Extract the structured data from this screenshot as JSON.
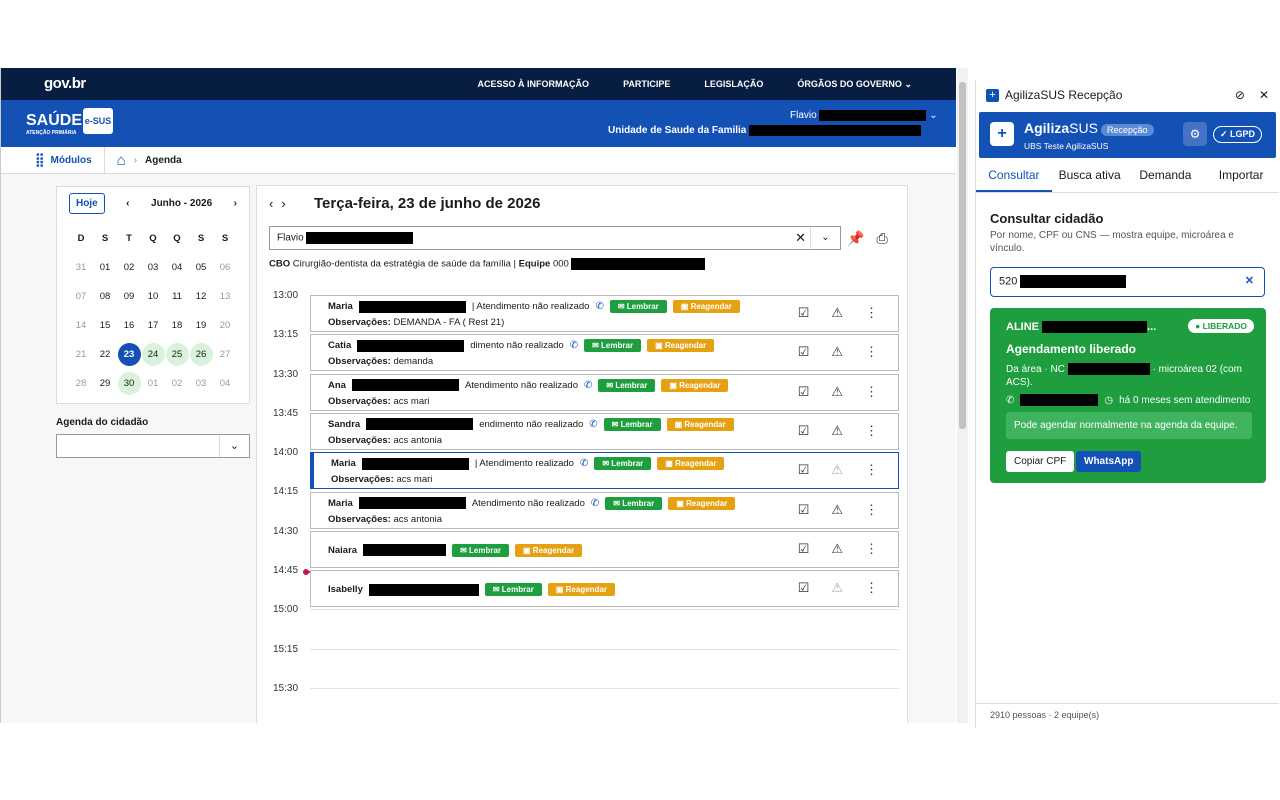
{
  "gov": {
    "logo": "gov.br",
    "links": [
      "ACESSO À INFORMAÇÃO",
      "PARTICIPE",
      "LEGISLAÇÃO",
      "ÓRGÃOS DO GOVERNO"
    ]
  },
  "header": {
    "brand": "SAÚDE",
    "brand_sub": "ATENÇÃO PRIMÁRIA",
    "esus": "e-SUS",
    "user": "Flavio",
    "unit": "Unidade de Saude da Familia"
  },
  "bread": {
    "modules": "Módulos",
    "page": "Agenda"
  },
  "calendar": {
    "today": "Hoje",
    "month": "Junho - 2026",
    "weekdays": [
      "D",
      "S",
      "T",
      "Q",
      "Q",
      "S",
      "S"
    ],
    "weeks": [
      [
        "31",
        "01",
        "02",
        "03",
        "04",
        "05",
        "06"
      ],
      [
        "07",
        "08",
        "09",
        "10",
        "11",
        "12",
        "13"
      ],
      [
        "14",
        "15",
        "16",
        "17",
        "18",
        "19",
        "20"
      ],
      [
        "21",
        "22",
        "23",
        "24",
        "25",
        "26",
        "27"
      ],
      [
        "28",
        "29",
        "30",
        "01",
        "02",
        "03",
        "04"
      ]
    ]
  },
  "citizen": {
    "label": "Agenda do cidadão"
  },
  "agenda": {
    "date": "Terça-feira, 23 de junho de 2026",
    "prof": "Flavio",
    "cbo_label": "CBO",
    "cbo": "Cirurgião-dentista da estratégia de saúde da família",
    "team_label": "Equipe",
    "team": "000",
    "times": [
      "13:00",
      "13:15",
      "13:30",
      "13:45",
      "14:00",
      "14:15",
      "14:30",
      "14:45",
      "15:00",
      "15:15",
      "15:30"
    ],
    "obs_label": "Observações:",
    "remind": "Lembrar",
    "resched": "Reagendar",
    "appts": [
      {
        "name": "Maria",
        "status": "| Atendimento não realizado",
        "obs": "DEMANDA - FA ( Rest 21)"
      },
      {
        "name": "Catia",
        "status": "dimento não realizado",
        "obs": "demanda"
      },
      {
        "name": "Ana",
        "status": "Atendimento não realizado",
        "obs": "acs mari"
      },
      {
        "name": "Sandra",
        "status": "endimento não realizado",
        "obs": "acs antonia"
      },
      {
        "name": "Maria",
        "status": "| Atendimento realizado",
        "obs": "acs mari"
      },
      {
        "name": "Maria",
        "status": "Atendimento não realizado",
        "obs": "acs antonia"
      },
      {
        "name": "Naiara",
        "status": "",
        "obs": ""
      },
      {
        "name": "Isabelly",
        "status": "",
        "obs": ""
      }
    ]
  },
  "panel": {
    "title": "AgilizaSUS Recepção",
    "brand": "Agiliza",
    "brand2": "SUS",
    "tag": "Recepção",
    "ubs": "UBS Teste AgilizaSUS",
    "lgpd": "LGPD",
    "tabs": [
      "Consultar",
      "Busca ativa",
      "Demanda",
      "Importar"
    ],
    "heading": "Consultar cidadão",
    "desc": "Por nome, CPF ou CNS — mostra equipe, microárea e vínculo.",
    "query": "520",
    "card": {
      "name": "ALINE",
      "dots": "...",
      "badge": "LIBERADO",
      "title": "Agendamento liberado",
      "area1": "Da área · NC",
      "area2": "· microárea 02 (com ACS).",
      "months": "há 0 meses sem atendimento",
      "ok": "Pode agendar normalmente na agenda da equipe.",
      "copy": "Copiar CPF",
      "whatsapp": "WhatsApp"
    },
    "footer": "2910 pessoas · 2 equipe(s)"
  }
}
